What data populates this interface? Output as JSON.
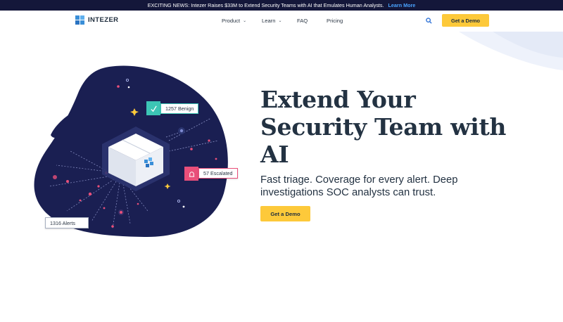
{
  "announcement": {
    "text": "EXCITING NEWS: Intezer Raises $33M to Extend Security Teams with AI that Emulates Human Analysts.",
    "link": "Learn More"
  },
  "nav": {
    "logo_text": "INTEZER",
    "items": [
      {
        "label": "Product",
        "has_dropdown": true
      },
      {
        "label": "Learn",
        "has_dropdown": true
      },
      {
        "label": "FAQ",
        "has_dropdown": false
      },
      {
        "label": "Pricing",
        "has_dropdown": false
      }
    ],
    "cta": "Get a Demo"
  },
  "hero": {
    "headline_lines": [
      "Extend Your",
      "Security Team with",
      "AI"
    ],
    "subheadline_lines": [
      "Fast triage. Coverage for every alert. Deep",
      "investigations SOC analysts can trust."
    ],
    "cta": "Get a Demo"
  },
  "illustration": {
    "chips": {
      "benign": "1257 Benign",
      "escalated": "57 Escalated",
      "alerts": "1316 Alerts"
    }
  },
  "colors": {
    "accent": "#fdc93a",
    "navy": "#14173a",
    "blob": "#1a1f52",
    "teal": "#3cc5b5",
    "pink": "#e94f7a",
    "link": "#4aa3ff"
  }
}
